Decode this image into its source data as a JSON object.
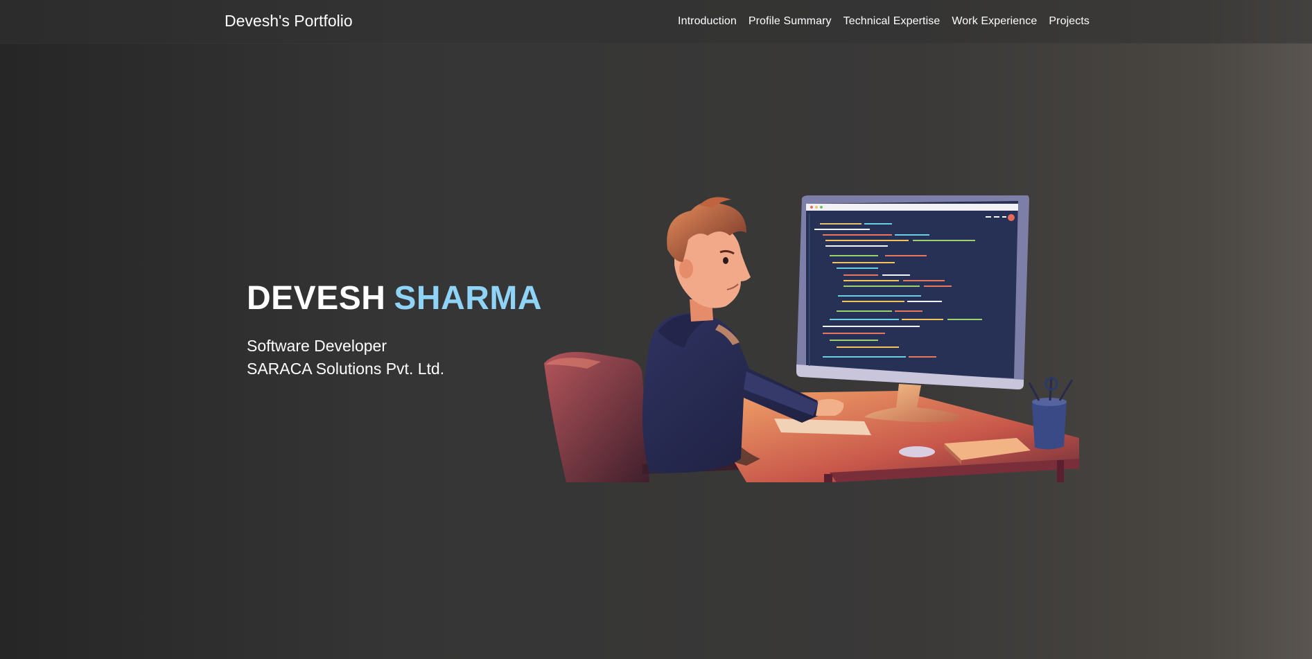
{
  "nav": {
    "brand": "Devesh's Portfolio",
    "links": [
      {
        "label": "Introduction"
      },
      {
        "label": "Profile Summary"
      },
      {
        "label": "Technical Expertise"
      },
      {
        "label": "Work Experience"
      },
      {
        "label": "Projects"
      }
    ]
  },
  "hero": {
    "first_name": "DEVESH",
    "last_name": "SHARMA",
    "role": "Software Developer",
    "company": "SARACA Solutions Pvt. Ltd."
  },
  "colors": {
    "accent": "#8fd3f7",
    "text": "#ffffff",
    "background": "#353535"
  },
  "illustration": {
    "icon": "developer-at-computer-illustration"
  }
}
